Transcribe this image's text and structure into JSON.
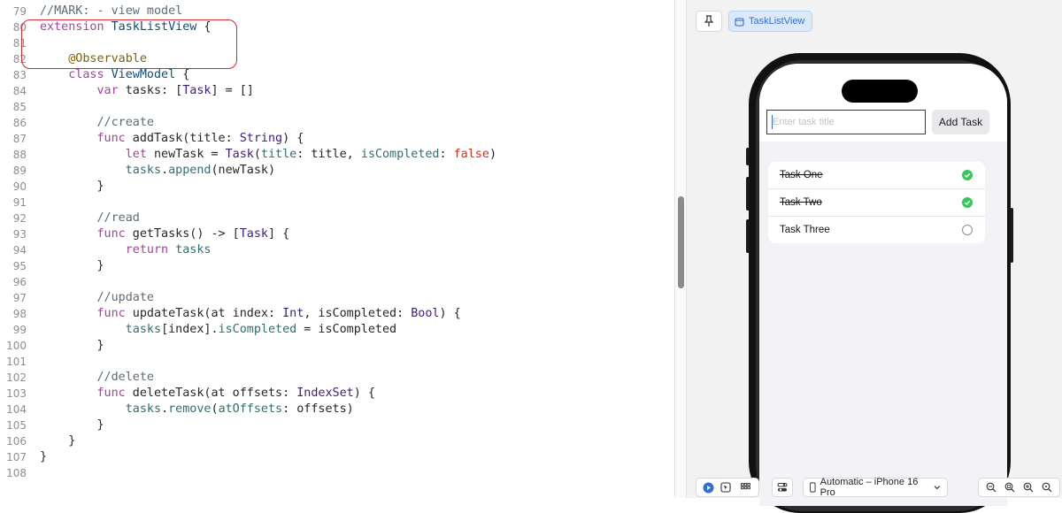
{
  "editor": {
    "lines": [
      {
        "n": "79",
        "tokens": [
          [
            "cm",
            "//MARK: - view model"
          ]
        ]
      },
      {
        "n": "80",
        "tokens": [
          [
            "kw",
            "extension"
          ],
          [
            "pl",
            " "
          ],
          [
            "tyd",
            "TaskListView"
          ],
          [
            "pl",
            " {"
          ]
        ]
      },
      {
        "n": "81",
        "tokens": []
      },
      {
        "n": "82",
        "tokens": [
          [
            "pl",
            "    "
          ],
          [
            "at",
            "@Observable"
          ]
        ]
      },
      {
        "n": "83",
        "tokens": [
          [
            "pl",
            "    "
          ],
          [
            "kw",
            "class"
          ],
          [
            "pl",
            " "
          ],
          [
            "tyd",
            "ViewModel"
          ],
          [
            "pl",
            " {"
          ]
        ]
      },
      {
        "n": "84",
        "tokens": [
          [
            "pl",
            "        "
          ],
          [
            "kw",
            "var"
          ],
          [
            "pl",
            " tasks: ["
          ],
          [
            "ty",
            "Task"
          ],
          [
            "pl",
            "] = []"
          ]
        ]
      },
      {
        "n": "85",
        "tokens": []
      },
      {
        "n": "86",
        "tokens": [
          [
            "pl",
            "        "
          ],
          [
            "cm",
            "//create"
          ]
        ]
      },
      {
        "n": "87",
        "tokens": [
          [
            "pl",
            "        "
          ],
          [
            "kw",
            "func"
          ],
          [
            "pl",
            " addTask(title: "
          ],
          [
            "ty",
            "String"
          ],
          [
            "pl",
            ") {"
          ]
        ]
      },
      {
        "n": "88",
        "tokens": [
          [
            "pl",
            "            "
          ],
          [
            "kw",
            "let"
          ],
          [
            "pl",
            " newTask = "
          ],
          [
            "ty",
            "Task"
          ],
          [
            "pl",
            "("
          ],
          [
            "fn",
            "title"
          ],
          [
            "pl",
            ": title, "
          ],
          [
            "fn",
            "isCompleted"
          ],
          [
            "pl",
            ": "
          ],
          [
            "lit",
            "false"
          ],
          [
            "pl",
            ")"
          ]
        ]
      },
      {
        "n": "89",
        "tokens": [
          [
            "pl",
            "            "
          ],
          [
            "fn",
            "tasks"
          ],
          [
            "pl",
            "."
          ],
          [
            "fn",
            "append"
          ],
          [
            "pl",
            "(newTask)"
          ]
        ]
      },
      {
        "n": "90",
        "tokens": [
          [
            "pl",
            "        }"
          ]
        ]
      },
      {
        "n": "91",
        "tokens": []
      },
      {
        "n": "92",
        "tokens": [
          [
            "pl",
            "        "
          ],
          [
            "cm",
            "//read"
          ]
        ]
      },
      {
        "n": "93",
        "tokens": [
          [
            "pl",
            "        "
          ],
          [
            "kw",
            "func"
          ],
          [
            "pl",
            " getTasks() -> ["
          ],
          [
            "ty",
            "Task"
          ],
          [
            "pl",
            "] {"
          ]
        ]
      },
      {
        "n": "94",
        "tokens": [
          [
            "pl",
            "            "
          ],
          [
            "kw",
            "return"
          ],
          [
            "pl",
            " "
          ],
          [
            "fn",
            "tasks"
          ]
        ]
      },
      {
        "n": "95",
        "tokens": [
          [
            "pl",
            "        }"
          ]
        ]
      },
      {
        "n": "96",
        "tokens": []
      },
      {
        "n": "97",
        "tokens": [
          [
            "pl",
            "        "
          ],
          [
            "cm",
            "//update"
          ]
        ]
      },
      {
        "n": "98",
        "tokens": [
          [
            "pl",
            "        "
          ],
          [
            "kw",
            "func"
          ],
          [
            "pl",
            " updateTask(at index: "
          ],
          [
            "ty",
            "Int"
          ],
          [
            "pl",
            ", isCompleted: "
          ],
          [
            "ty",
            "Bool"
          ],
          [
            "pl",
            ") {"
          ]
        ]
      },
      {
        "n": "99",
        "tokens": [
          [
            "pl",
            "            "
          ],
          [
            "fn",
            "tasks"
          ],
          [
            "pl",
            "[index]."
          ],
          [
            "fn",
            "isCompleted"
          ],
          [
            "pl",
            " = isCompleted"
          ]
        ]
      },
      {
        "n": "100",
        "tokens": [
          [
            "pl",
            "        }"
          ]
        ]
      },
      {
        "n": "101",
        "tokens": []
      },
      {
        "n": "102",
        "tokens": [
          [
            "pl",
            "        "
          ],
          [
            "cm",
            "//delete"
          ]
        ]
      },
      {
        "n": "103",
        "tokens": [
          [
            "pl",
            "        "
          ],
          [
            "kw",
            "func"
          ],
          [
            "pl",
            " deleteTask(at offsets: "
          ],
          [
            "ty",
            "IndexSet"
          ],
          [
            "pl",
            ") {"
          ]
        ]
      },
      {
        "n": "104",
        "tokens": [
          [
            "pl",
            "            "
          ],
          [
            "fn",
            "tasks"
          ],
          [
            "pl",
            "."
          ],
          [
            "fn",
            "remove"
          ],
          [
            "pl",
            "("
          ],
          [
            "fn",
            "atOffsets"
          ],
          [
            "pl",
            ": offsets)"
          ]
        ]
      },
      {
        "n": "105",
        "tokens": [
          [
            "pl",
            "        }"
          ]
        ]
      },
      {
        "n": "106",
        "tokens": [
          [
            "pl",
            "    }"
          ]
        ]
      },
      {
        "n": "107",
        "tokens": [
          [
            "pl",
            "}"
          ]
        ]
      },
      {
        "n": "108",
        "tokens": []
      }
    ]
  },
  "canvas": {
    "pin_icon": "pin-icon",
    "preview_chip_label": "TaskListView",
    "preview_chip_icon": "window-icon",
    "input_placeholder": "Enter task title",
    "add_button_label": "Add Task",
    "tasks": [
      {
        "title": "Task One",
        "completed": true
      },
      {
        "title": "Task Two",
        "completed": true
      },
      {
        "title": "Task Three",
        "completed": false
      }
    ],
    "bottom_bar": {
      "live_icon": "play-icon",
      "selectable_icon": "cursor-icon",
      "variants_icon": "grid-icon",
      "settings_icon": "sliders-icon",
      "device_label": "Automatic – iPhone 16 Pro",
      "device_icon": "iphone-icon",
      "zoom_icons": [
        "zoom-out-icon",
        "zoom-fit-icon",
        "zoom-in-icon",
        "zoom-actual-icon"
      ]
    }
  },
  "colors": {
    "keyword": "#ad3da4",
    "type": "#3d1d81",
    "comment": "#5d6c79",
    "annotation": "#805e03",
    "literal": "#d12f1b",
    "highlight_box": "#d8262e",
    "accent": "#2f6fd6",
    "check_green": "#34c759"
  }
}
